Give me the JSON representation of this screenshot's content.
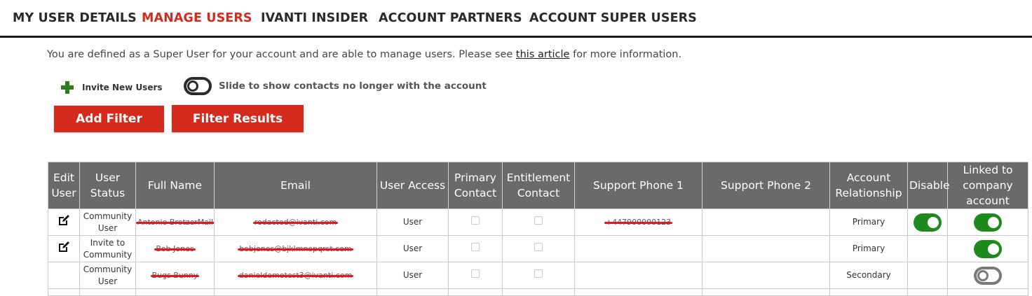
{
  "nav": {
    "tabs": [
      {
        "label": "MY USER DETAILS"
      },
      {
        "label": "MANAGE USERS"
      },
      {
        "label": "IVANTI INSIDER"
      },
      {
        "label": "ACCOUNT PARTNERS"
      },
      {
        "label": "ACCOUNT SUPER USERS"
      }
    ],
    "active": "MANAGE USERS"
  },
  "intro": {
    "before": "You are defined as a Super User for your account and are able to manage users. Please see ",
    "link": "this article",
    "after": " for more information."
  },
  "controls": {
    "invite_label": "Invite New Users",
    "slider_label": "Slide to show contacts no longer with the account",
    "add_filter": "Add Filter",
    "filter_results": "Filter Results"
  },
  "table": {
    "headers": [
      "Edit User",
      "User Status",
      "Full Name",
      "Email",
      "User Access",
      "Primary Contact",
      "Entitlement Contact",
      "Support Phone 1",
      "Support Phone 2",
      "Account Relationship",
      "Disable",
      "Linked to company account"
    ],
    "rows": [
      {
        "status": "Community User",
        "full_name": "Antonio BrotzerMail Test",
        "email": "redacted@ivanti.com",
        "access": "User",
        "phone1": "+447900000123",
        "phone2": "",
        "relationship": "Primary"
      },
      {
        "status": "Invite to Community",
        "full_name": "Bob Jones",
        "email": "bobjones@bjklmnopqrst.com",
        "access": "User",
        "phone1": "",
        "phone2": "",
        "relationship": "Primary"
      },
      {
        "status": "Community User",
        "full_name": "Bugs Bunny",
        "email": "danieldemotest3@ivanti.com",
        "access": "User",
        "phone1": "",
        "phone2": "",
        "relationship": "Secondary"
      }
    ]
  },
  "colors": {
    "accent_red": "#d52b1e",
    "toggle_on": "#1e8a1e",
    "header_bg": "#6a6a6a",
    "status_invite": "#2e7d1e"
  }
}
